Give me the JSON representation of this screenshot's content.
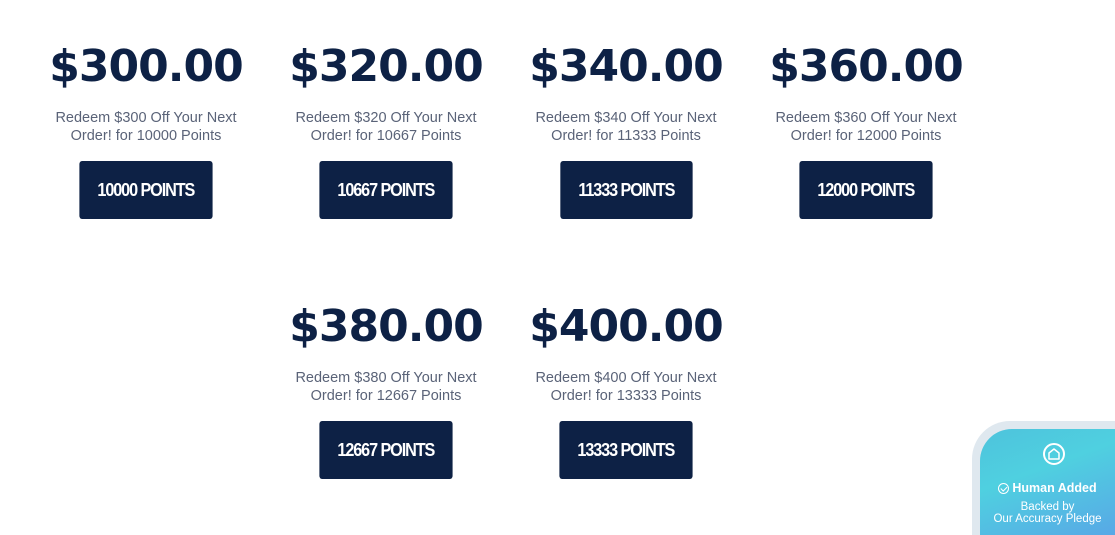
{
  "rewards": [
    {
      "price": "$300.00",
      "desc_line1": "Redeem $300 Off Your Next",
      "desc_line2": "Order! for 10000 Points",
      "button": "10000 POINTS"
    },
    {
      "price": "$320.00",
      "desc_line1": "Redeem $320 Off Your Next",
      "desc_line2": "Order! for 10667 Points",
      "button": "10667 POINTS"
    },
    {
      "price": "$340.00",
      "desc_line1": "Redeem $340 Off Your Next",
      "desc_line2": "Order! for 11333 Points",
      "button": "11333 POINTS"
    },
    {
      "price": "$360.00",
      "desc_line1": "Redeem $360 Off Your Next",
      "desc_line2": "Order! for 12000 Points",
      "button": "12000 POINTS"
    },
    {
      "price": "$380.00",
      "desc_line1": "Redeem $380 Off Your Next",
      "desc_line2": "Order! for 12667 Points",
      "button": "12667 POINTS"
    },
    {
      "price": "$400.00",
      "desc_line1": "Redeem $400 Off Your Next",
      "desc_line2": "Order! for 13333 Points",
      "button": "13333 POINTS"
    }
  ],
  "badge": {
    "icon": "shield-home-icon",
    "title": "Human Added",
    "line1": "Backed by",
    "line2": "Our Accuracy Pledge"
  },
  "colors": {
    "brand_navy": "#0d2145",
    "desc_gray": "#5a6378",
    "badge_teal": "#4fd0e0"
  }
}
